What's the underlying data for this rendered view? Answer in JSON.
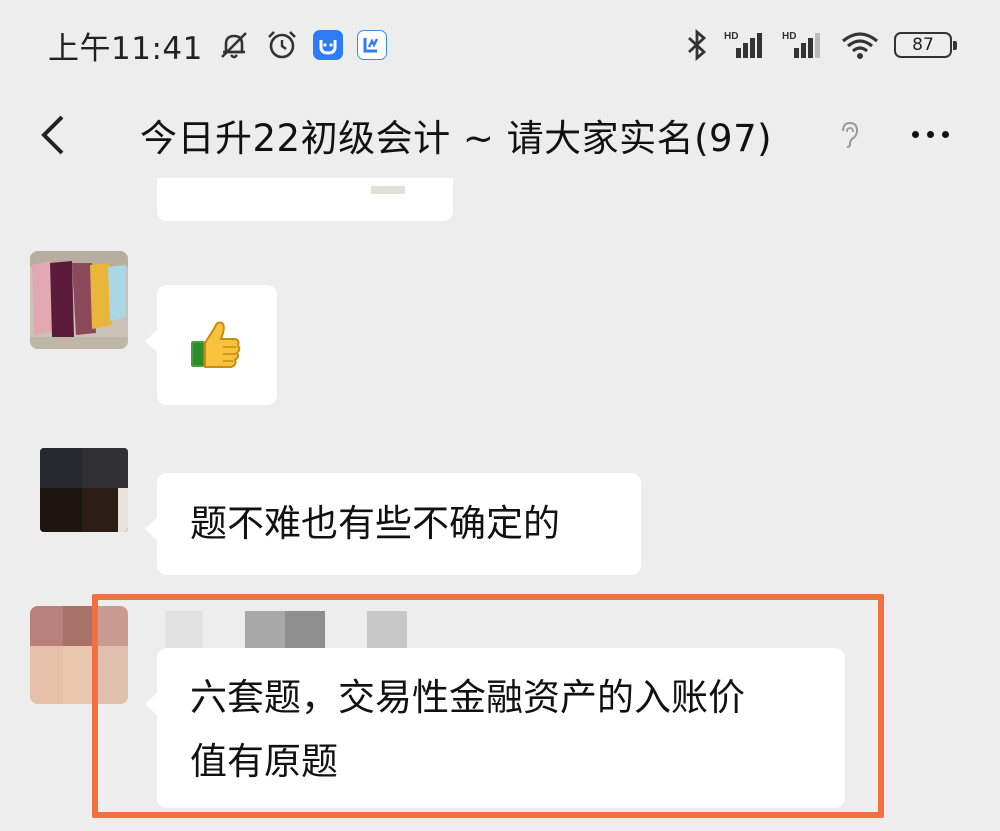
{
  "status_bar": {
    "time": "上午11:41",
    "battery": "87",
    "left_icons": [
      "mute-bell-icon",
      "alarm-icon",
      "app-notification-icon",
      "app-notification-icon-2"
    ],
    "right_icons": [
      "bluetooth-icon",
      "signal-hd-icon",
      "signal-hd-icon-2",
      "wifi-icon"
    ],
    "network_label": "HD"
  },
  "header": {
    "title": "今日升22初级会计 ~ 请大家实名(97)",
    "back_icon": "chevron-left-icon",
    "mute_icon": "ear-icon",
    "more_icon": "more-dots-icon"
  },
  "messages": [
    {
      "type": "partial",
      "text": ""
    },
    {
      "type": "emoji",
      "emoji": "👍"
    },
    {
      "type": "text",
      "text": "题不难也有些不确定的"
    },
    {
      "type": "text",
      "lines": [
        "六套题，交易性金融资产的入账价",
        "值有原题"
      ],
      "highlighted": true
    }
  ],
  "colors": {
    "background": "#ededed",
    "bubble": "#ffffff",
    "highlight": "#f26f3f"
  }
}
